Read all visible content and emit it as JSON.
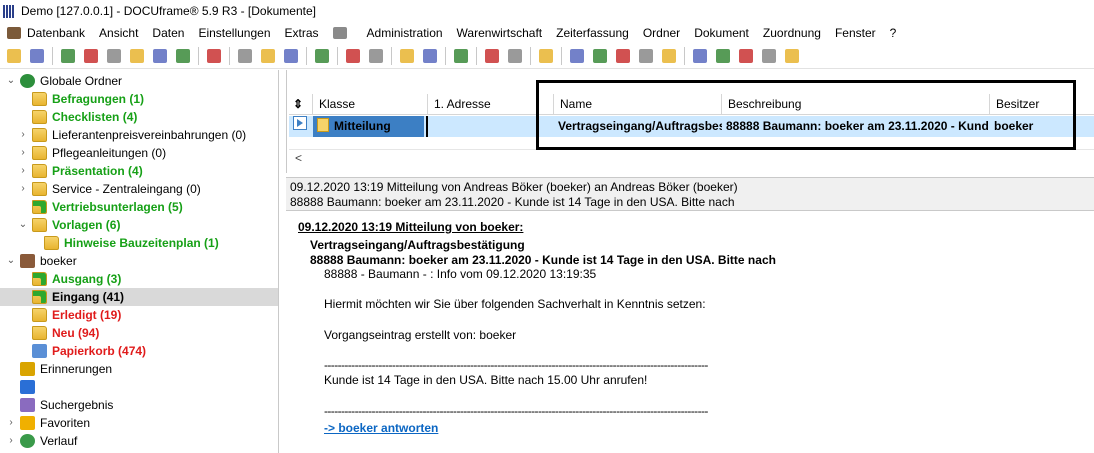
{
  "window": {
    "title": "Demo [127.0.0.1] - DOCUframe® 5.9 R3 - [Dokumente]"
  },
  "menubar": [
    {
      "label": "Datenbank",
      "icon": "database-icon",
      "color": "#7b5a3a"
    },
    {
      "label": "Ansicht"
    },
    {
      "label": "Daten"
    },
    {
      "label": "Einstellungen"
    },
    {
      "label": "Extras"
    },
    {
      "label": "",
      "icon": "keyboard-icon",
      "color": "#8a8a8a"
    },
    {
      "label": "Administration"
    },
    {
      "label": "Warenwirtschaft"
    },
    {
      "label": "Zeiterfassung"
    },
    {
      "label": "Ordner"
    },
    {
      "label": "Dokument"
    },
    {
      "label": "Zuordnung"
    },
    {
      "label": "Fenster"
    },
    {
      "label": "?"
    }
  ],
  "toolbar": {
    "groups": [
      [
        "new-document-icon",
        "print-icon"
      ],
      [
        "card-icon",
        "list-icon",
        "contact-icon",
        "tag-icon",
        "calendar-icon",
        "calendar-red-icon"
      ],
      [
        "phone-icon"
      ],
      [
        "folder-open-icon",
        "folder-new-icon",
        "folder-save-icon"
      ],
      [
        "search-icon"
      ],
      [
        "document-stack-icon",
        "document-delete-icon"
      ],
      [
        "document-copy-icon",
        "document-red-icon"
      ],
      [
        "glasses-icon"
      ],
      [
        "users-icon",
        "user-group-icon"
      ],
      [
        "pin-icon"
      ],
      [
        "doc-attach-icon",
        "doc-attach-2-icon",
        "doc-link-icon",
        "doc-link-2-icon",
        "doc-refresh-icon"
      ],
      [
        "doc-unlink-icon",
        "doc-unlink-2-icon",
        "doc-unlink-3-icon",
        "doc-unlink-4-icon",
        "doc-remove-icon"
      ]
    ],
    "colors": [
      "#e8b430",
      "#5a6bbf",
      "#3a8a3a",
      "#c93333",
      "#888888"
    ]
  },
  "tree": [
    {
      "label": "Globale Ordner",
      "level": 0,
      "chevron": "open",
      "icon": "globe-icon",
      "style": "normal"
    },
    {
      "label": "Befragungen (1)",
      "level": 1,
      "chevron": "",
      "icon": "folder-icon",
      "style": "green"
    },
    {
      "label": "Checklisten (4)",
      "level": 1,
      "chevron": "",
      "icon": "folder-icon",
      "style": "green"
    },
    {
      "label": "Lieferantenpreisvereinbahrungen (0)",
      "level": 1,
      "chevron": "closed",
      "icon": "folder-icon",
      "style": "normal"
    },
    {
      "label": "Pflegeanleitungen (0)",
      "level": 1,
      "chevron": "closed",
      "icon": "folder-icon",
      "style": "normal"
    },
    {
      "label": "Präsentation (4)",
      "level": 1,
      "chevron": "closed",
      "icon": "folder-icon",
      "style": "green"
    },
    {
      "label": "Service - Zentraleingang (0)",
      "level": 1,
      "chevron": "closed",
      "icon": "folder-icon",
      "style": "normal"
    },
    {
      "label": "Vertriebsunterlagen (5)",
      "level": 1,
      "chevron": "",
      "icon": "folder-arrow-icon",
      "style": "green"
    },
    {
      "label": "Vorlagen (6)",
      "level": 1,
      "chevron": "open",
      "icon": "folder-icon",
      "style": "green"
    },
    {
      "label": "Hinweise Bauzeitenplan (1)",
      "level": 2,
      "chevron": "",
      "icon": "folder-icon",
      "style": "green"
    },
    {
      "label": "boeker",
      "level": 0,
      "chevron": "open",
      "icon": "user-icon",
      "style": "normal"
    },
    {
      "label": "Ausgang (3)",
      "level": 1,
      "chevron": "",
      "icon": "outbox-icon",
      "style": "green"
    },
    {
      "label": "Eingang (41)",
      "level": 1,
      "chevron": "",
      "icon": "inbox-icon",
      "style": "bold",
      "selected": true
    },
    {
      "label": "Erledigt (19)",
      "level": 1,
      "chevron": "",
      "icon": "folder-done-icon",
      "style": "red"
    },
    {
      "label": "Neu (94)",
      "level": 1,
      "chevron": "",
      "icon": "folder-new-icon",
      "style": "red"
    },
    {
      "label": "Papierkorb (474)",
      "level": 1,
      "chevron": "",
      "icon": "trash-icon",
      "style": "red"
    },
    {
      "label": "Erinnerungen",
      "level": 0,
      "chevron": "",
      "icon": "bell-icon",
      "style": "normal"
    },
    {
      "label": "",
      "level": 0,
      "chevron": "",
      "icon": "pin-icon",
      "style": "normal"
    },
    {
      "label": "Suchergebnis",
      "level": 0,
      "chevron": "",
      "icon": "search-result-icon",
      "style": "normal"
    },
    {
      "label": "Favoriten",
      "level": 0,
      "chevron": "closed",
      "icon": "star-icon",
      "style": "normal"
    },
    {
      "label": "Verlauf",
      "level": 0,
      "chevron": "closed",
      "icon": "history-icon",
      "style": "normal"
    }
  ],
  "grid": {
    "columns": [
      "Klasse",
      "1. Adresse",
      "Name",
      "Beschreibung",
      "Besitzer"
    ],
    "rows": [
      {
        "klasse": "Mitteilung",
        "adresse": "",
        "name": "Vertragseingang/Auftragsbes",
        "beschreibung": "88888 Baumann: boeker am 23.11.2020 - Kund",
        "besitzer": "boeker"
      }
    ],
    "scroll_left": "<"
  },
  "preview": {
    "header_line1": "09.12.2020 13:19 Mitteilung von Andreas Böker (boeker) an Andreas Böker (boeker)",
    "header_line2": "88888 Baumann: boeker am 23.11.2020 - Kunde ist 14 Tage in den USA. Bitte nach",
    "title": "09.12.2020 13:19 Mitteilung von boeker:",
    "subject1": "Vertragseingang/Auftragsbestätigung",
    "subject2": "88888 Baumann: boeker am 23.11.2020 - Kunde ist 14 Tage in den USA. Bitte nach",
    "info": "88888 - Baumann - : Info vom 09.12.2020 13:19:35",
    "intro": "Hiermit möchten wir Sie über folgenden Sachverhalt in Kenntnis setzen:",
    "creator": "Vorgangseintrag erstellt von: boeker",
    "separator": "-----------------------------------------------------------------------------------------------------------------",
    "body": "Kunde ist 14 Tage in den USA. Bitte nach 15.00 Uhr anrufen!",
    "reply_link": "-> boeker antworten"
  }
}
